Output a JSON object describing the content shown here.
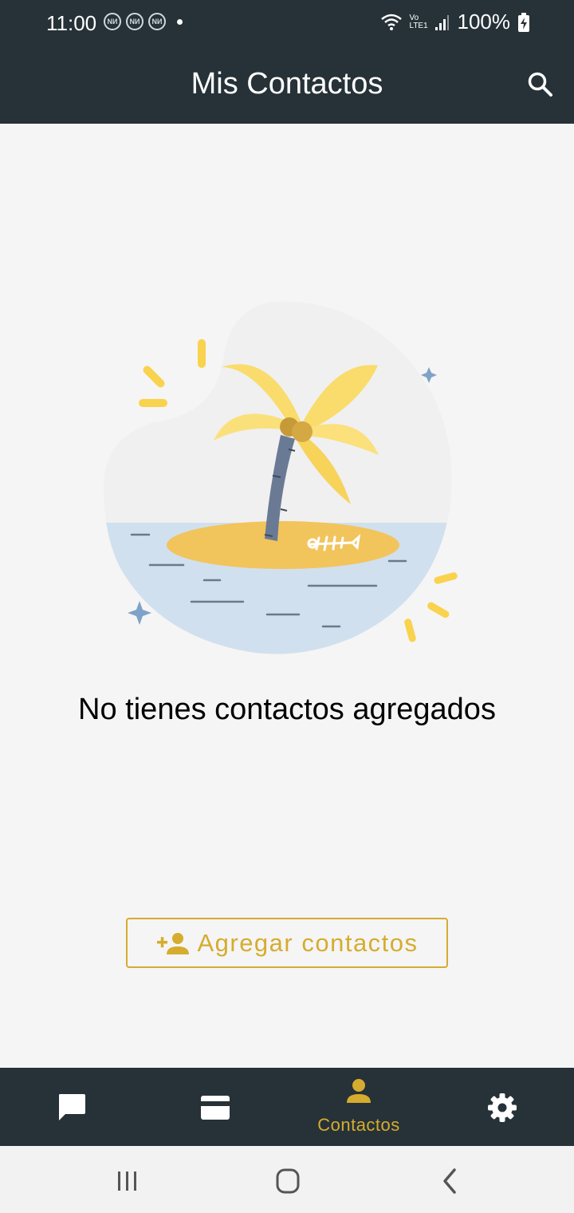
{
  "status_bar": {
    "time": "11:00",
    "notification_icons": [
      "NИ",
      "NИ",
      "NИ"
    ],
    "battery": "100%",
    "network_label": "Vo LTE1"
  },
  "app_bar": {
    "title": "Mis Contactos",
    "search_icon": "search-icon"
  },
  "empty_state": {
    "message": "No tienes contactos agregados",
    "illustration": "desert-island-illustration"
  },
  "add_contacts_button": {
    "label": "Agregar contactos",
    "icon": "person-add-icon"
  },
  "bottom_nav": {
    "items": [
      {
        "icon": "chat-icon",
        "label": "",
        "active": false
      },
      {
        "icon": "card-icon",
        "label": "",
        "active": false
      },
      {
        "icon": "person-icon",
        "label": "Contactos",
        "active": true
      },
      {
        "icon": "gear-icon",
        "label": "",
        "active": false
      }
    ]
  },
  "colors": {
    "bar_background": "#263238",
    "accent": "#d6ac2e",
    "page_background": "#f5f5f5"
  }
}
